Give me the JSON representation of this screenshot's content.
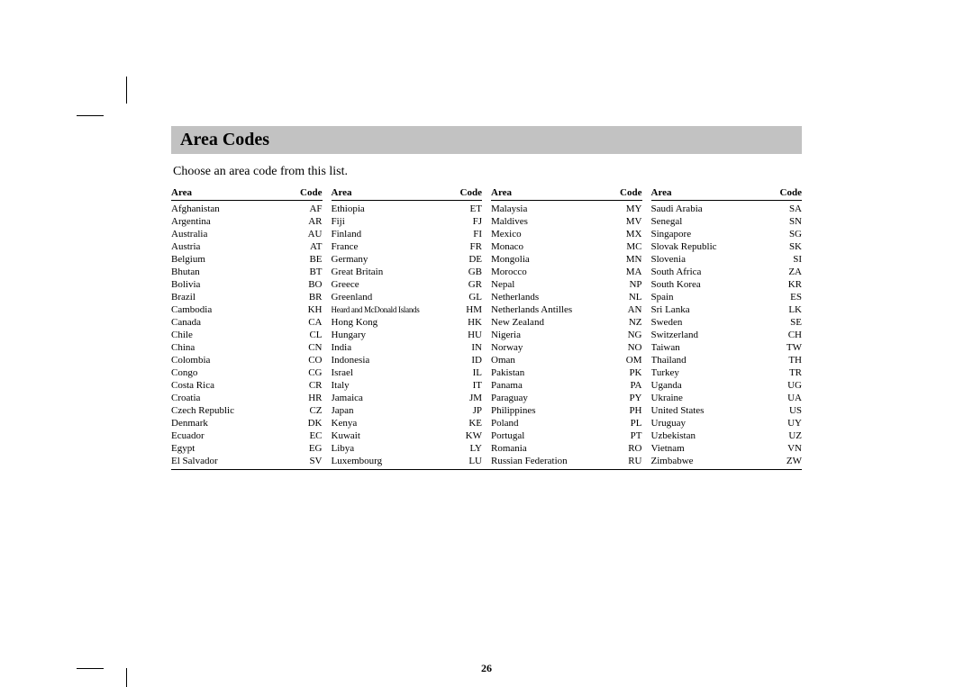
{
  "title": "Area Codes",
  "instructions": "Choose an area code from this list.",
  "page_number": "26",
  "header": {
    "area": "Area",
    "code": "Code"
  },
  "columns": [
    [
      {
        "area": "Afghanistan",
        "code": "AF"
      },
      {
        "area": "Argentina",
        "code": "AR"
      },
      {
        "area": "Australia",
        "code": "AU"
      },
      {
        "area": "Austria",
        "code": "AT"
      },
      {
        "area": "Belgium",
        "code": "BE"
      },
      {
        "area": "Bhutan",
        "code": "BT"
      },
      {
        "area": "Bolivia",
        "code": "BO"
      },
      {
        "area": "Brazil",
        "code": "BR"
      },
      {
        "area": "Cambodia",
        "code": "KH"
      },
      {
        "area": "Canada",
        "code": "CA"
      },
      {
        "area": "Chile",
        "code": "CL"
      },
      {
        "area": "China",
        "code": "CN"
      },
      {
        "area": "Colombia",
        "code": "CO"
      },
      {
        "area": "Congo",
        "code": "CG"
      },
      {
        "area": "Costa Rica",
        "code": "CR"
      },
      {
        "area": "Croatia",
        "code": "HR"
      },
      {
        "area": "Czech Republic",
        "code": "CZ"
      },
      {
        "area": "Denmark",
        "code": "DK"
      },
      {
        "area": "Ecuador",
        "code": "EC"
      },
      {
        "area": "Egypt",
        "code": "EG"
      },
      {
        "area": "El Salvador",
        "code": "SV"
      }
    ],
    [
      {
        "area": "Ethiopia",
        "code": "ET"
      },
      {
        "area": "Fiji",
        "code": "FJ"
      },
      {
        "area": "Finland",
        "code": "FI"
      },
      {
        "area": "France",
        "code": "FR"
      },
      {
        "area": "Germany",
        "code": "DE"
      },
      {
        "area": "Great Britain",
        "code": "GB"
      },
      {
        "area": "Greece",
        "code": "GR"
      },
      {
        "area": "Greenland",
        "code": "GL"
      },
      {
        "area": "Heard and McDonald Islands",
        "code": "HM",
        "small": true
      },
      {
        "area": "Hong Kong",
        "code": "HK"
      },
      {
        "area": "Hungary",
        "code": "HU"
      },
      {
        "area": "India",
        "code": "IN"
      },
      {
        "area": "Indonesia",
        "code": "ID"
      },
      {
        "area": "Israel",
        "code": "IL"
      },
      {
        "area": "Italy",
        "code": "IT"
      },
      {
        "area": "Jamaica",
        "code": "JM"
      },
      {
        "area": "Japan",
        "code": "JP"
      },
      {
        "area": "Kenya",
        "code": "KE"
      },
      {
        "area": "Kuwait",
        "code": "KW"
      },
      {
        "area": "Libya",
        "code": "LY"
      },
      {
        "area": "Luxembourg",
        "code": "LU"
      }
    ],
    [
      {
        "area": "Malaysia",
        "code": "MY"
      },
      {
        "area": "Maldives",
        "code": "MV"
      },
      {
        "area": "Mexico",
        "code": "MX"
      },
      {
        "area": "Monaco",
        "code": "MC"
      },
      {
        "area": "Mongolia",
        "code": "MN"
      },
      {
        "area": "Morocco",
        "code": "MA"
      },
      {
        "area": "Nepal",
        "code": "NP"
      },
      {
        "area": "Netherlands",
        "code": "NL"
      },
      {
        "area": "Netherlands Antilles",
        "code": "AN"
      },
      {
        "area": "New Zealand",
        "code": "NZ"
      },
      {
        "area": "Nigeria",
        "code": "NG"
      },
      {
        "area": "Norway",
        "code": "NO"
      },
      {
        "area": "Oman",
        "code": "OM"
      },
      {
        "area": "Pakistan",
        "code": "PK"
      },
      {
        "area": "Panama",
        "code": "PA"
      },
      {
        "area": "Paraguay",
        "code": "PY"
      },
      {
        "area": "Philippines",
        "code": "PH"
      },
      {
        "area": "Poland",
        "code": "PL"
      },
      {
        "area": "Portugal",
        "code": "PT"
      },
      {
        "area": "Romania",
        "code": "RO"
      },
      {
        "area": "Russian Federation",
        "code": "RU"
      }
    ],
    [
      {
        "area": "Saudi Arabia",
        "code": "SA"
      },
      {
        "area": "Senegal",
        "code": "SN"
      },
      {
        "area": "Singapore",
        "code": "SG"
      },
      {
        "area": "Slovak Republic",
        "code": "SK"
      },
      {
        "area": "Slovenia",
        "code": "SI"
      },
      {
        "area": "South Africa",
        "code": "ZA"
      },
      {
        "area": "South Korea",
        "code": "KR"
      },
      {
        "area": "Spain",
        "code": "ES"
      },
      {
        "area": "Sri Lanka",
        "code": "LK"
      },
      {
        "area": "Sweden",
        "code": "SE"
      },
      {
        "area": "Switzerland",
        "code": "CH"
      },
      {
        "area": "Taiwan",
        "code": "TW"
      },
      {
        "area": "Thailand",
        "code": "TH"
      },
      {
        "area": "Turkey",
        "code": "TR"
      },
      {
        "area": "Uganda",
        "code": "UG"
      },
      {
        "area": "Ukraine",
        "code": "UA"
      },
      {
        "area": "United States",
        "code": "US"
      },
      {
        "area": "Uruguay",
        "code": "UY"
      },
      {
        "area": "Uzbekistan",
        "code": "UZ"
      },
      {
        "area": "Vietnam",
        "code": "VN"
      },
      {
        "area": "Zimbabwe",
        "code": "ZW"
      }
    ]
  ]
}
